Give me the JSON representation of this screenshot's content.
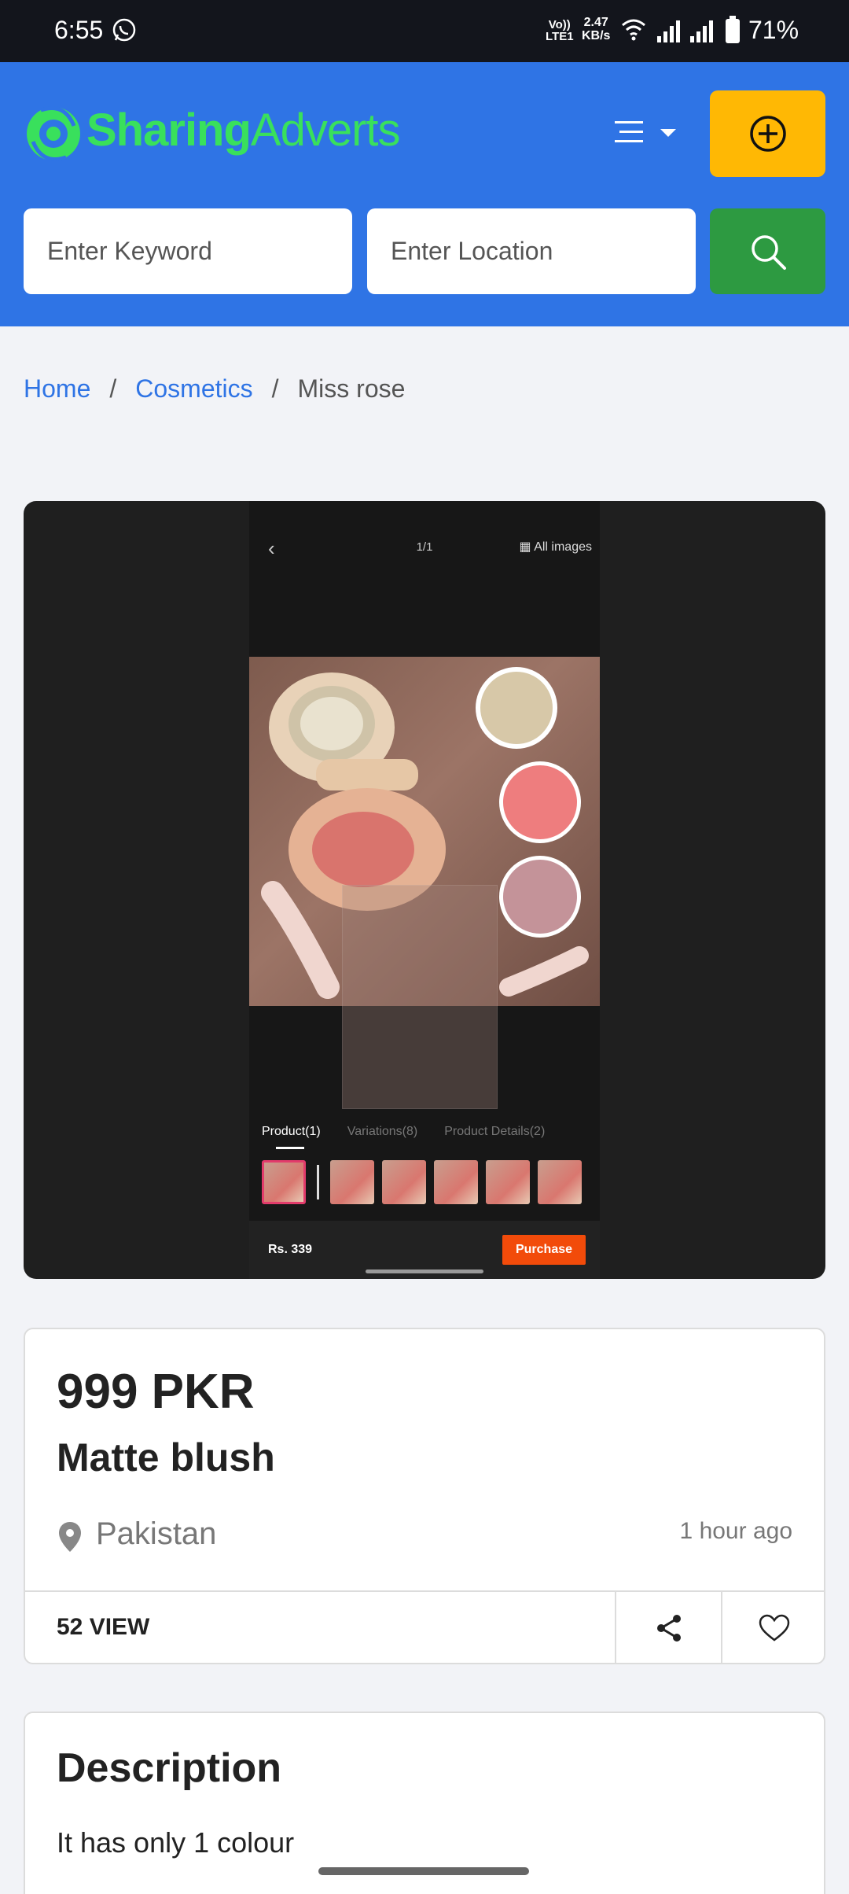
{
  "status_bar": {
    "time": "6:55",
    "volte_line1": "Vo))",
    "volte_line2": "LTE1",
    "speed_line1": "2.47",
    "speed_line2": "KB/s",
    "battery": "71%"
  },
  "header": {
    "logo_part1": "Sharing",
    "logo_part2": "Adverts",
    "keyword_placeholder": "Enter Keyword",
    "location_placeholder": "Enter Location",
    "accent_color": "#2f74e5",
    "add_button_color": "#ffb804",
    "search_button_color": "#2d9a41"
  },
  "breadcrumb": {
    "home": "Home",
    "separator": "/",
    "category": "Cosmetics",
    "current": "Miss rose"
  },
  "image_viewer": {
    "counter": "1/1",
    "all_images": "All images",
    "tabs": [
      "Product(1)",
      "Variations(8)",
      "Product Details(2)"
    ],
    "price": "Rs. 339",
    "purchase": "Purchase"
  },
  "product": {
    "price": "999 PKR",
    "title": "Matte blush",
    "location": "Pakistan",
    "posted": "1 hour ago",
    "views": "52 VIEW"
  },
  "description": {
    "heading": "Description",
    "text": "It has only 1 colour"
  }
}
